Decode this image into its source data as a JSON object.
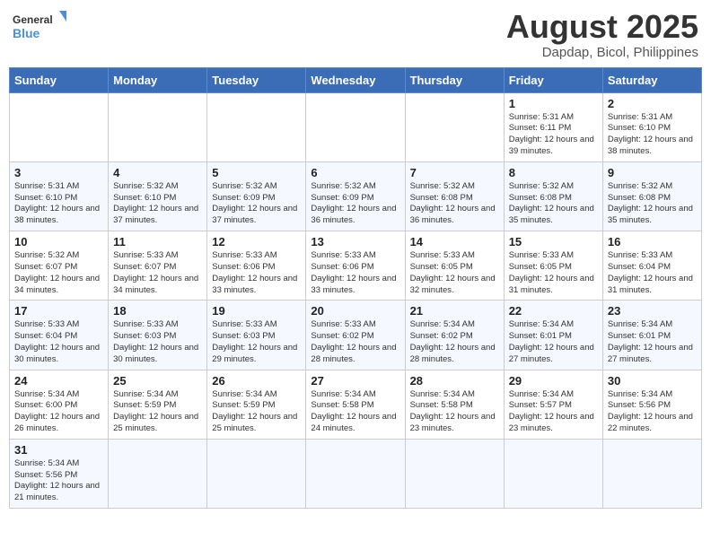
{
  "header": {
    "logo_general": "General",
    "logo_blue": "Blue",
    "title": "August 2025",
    "subtitle": "Dapdap, Bicol, Philippines"
  },
  "weekdays": [
    "Sunday",
    "Monday",
    "Tuesday",
    "Wednesday",
    "Thursday",
    "Friday",
    "Saturday"
  ],
  "weeks": [
    [
      {
        "day": "",
        "info": ""
      },
      {
        "day": "",
        "info": ""
      },
      {
        "day": "",
        "info": ""
      },
      {
        "day": "",
        "info": ""
      },
      {
        "day": "",
        "info": ""
      },
      {
        "day": "1",
        "info": "Sunrise: 5:31 AM\nSunset: 6:11 PM\nDaylight: 12 hours and 39 minutes."
      },
      {
        "day": "2",
        "info": "Sunrise: 5:31 AM\nSunset: 6:10 PM\nDaylight: 12 hours and 38 minutes."
      }
    ],
    [
      {
        "day": "3",
        "info": "Sunrise: 5:31 AM\nSunset: 6:10 PM\nDaylight: 12 hours and 38 minutes."
      },
      {
        "day": "4",
        "info": "Sunrise: 5:32 AM\nSunset: 6:10 PM\nDaylight: 12 hours and 37 minutes."
      },
      {
        "day": "5",
        "info": "Sunrise: 5:32 AM\nSunset: 6:09 PM\nDaylight: 12 hours and 37 minutes."
      },
      {
        "day": "6",
        "info": "Sunrise: 5:32 AM\nSunset: 6:09 PM\nDaylight: 12 hours and 36 minutes."
      },
      {
        "day": "7",
        "info": "Sunrise: 5:32 AM\nSunset: 6:08 PM\nDaylight: 12 hours and 36 minutes."
      },
      {
        "day": "8",
        "info": "Sunrise: 5:32 AM\nSunset: 6:08 PM\nDaylight: 12 hours and 35 minutes."
      },
      {
        "day": "9",
        "info": "Sunrise: 5:32 AM\nSunset: 6:08 PM\nDaylight: 12 hours and 35 minutes."
      }
    ],
    [
      {
        "day": "10",
        "info": "Sunrise: 5:32 AM\nSunset: 6:07 PM\nDaylight: 12 hours and 34 minutes."
      },
      {
        "day": "11",
        "info": "Sunrise: 5:33 AM\nSunset: 6:07 PM\nDaylight: 12 hours and 34 minutes."
      },
      {
        "day": "12",
        "info": "Sunrise: 5:33 AM\nSunset: 6:06 PM\nDaylight: 12 hours and 33 minutes."
      },
      {
        "day": "13",
        "info": "Sunrise: 5:33 AM\nSunset: 6:06 PM\nDaylight: 12 hours and 33 minutes."
      },
      {
        "day": "14",
        "info": "Sunrise: 5:33 AM\nSunset: 6:05 PM\nDaylight: 12 hours and 32 minutes."
      },
      {
        "day": "15",
        "info": "Sunrise: 5:33 AM\nSunset: 6:05 PM\nDaylight: 12 hours and 31 minutes."
      },
      {
        "day": "16",
        "info": "Sunrise: 5:33 AM\nSunset: 6:04 PM\nDaylight: 12 hours and 31 minutes."
      }
    ],
    [
      {
        "day": "17",
        "info": "Sunrise: 5:33 AM\nSunset: 6:04 PM\nDaylight: 12 hours and 30 minutes."
      },
      {
        "day": "18",
        "info": "Sunrise: 5:33 AM\nSunset: 6:03 PM\nDaylight: 12 hours and 30 minutes."
      },
      {
        "day": "19",
        "info": "Sunrise: 5:33 AM\nSunset: 6:03 PM\nDaylight: 12 hours and 29 minutes."
      },
      {
        "day": "20",
        "info": "Sunrise: 5:33 AM\nSunset: 6:02 PM\nDaylight: 12 hours and 28 minutes."
      },
      {
        "day": "21",
        "info": "Sunrise: 5:34 AM\nSunset: 6:02 PM\nDaylight: 12 hours and 28 minutes."
      },
      {
        "day": "22",
        "info": "Sunrise: 5:34 AM\nSunset: 6:01 PM\nDaylight: 12 hours and 27 minutes."
      },
      {
        "day": "23",
        "info": "Sunrise: 5:34 AM\nSunset: 6:01 PM\nDaylight: 12 hours and 27 minutes."
      }
    ],
    [
      {
        "day": "24",
        "info": "Sunrise: 5:34 AM\nSunset: 6:00 PM\nDaylight: 12 hours and 26 minutes."
      },
      {
        "day": "25",
        "info": "Sunrise: 5:34 AM\nSunset: 5:59 PM\nDaylight: 12 hours and 25 minutes."
      },
      {
        "day": "26",
        "info": "Sunrise: 5:34 AM\nSunset: 5:59 PM\nDaylight: 12 hours and 25 minutes."
      },
      {
        "day": "27",
        "info": "Sunrise: 5:34 AM\nSunset: 5:58 PM\nDaylight: 12 hours and 24 minutes."
      },
      {
        "day": "28",
        "info": "Sunrise: 5:34 AM\nSunset: 5:58 PM\nDaylight: 12 hours and 23 minutes."
      },
      {
        "day": "29",
        "info": "Sunrise: 5:34 AM\nSunset: 5:57 PM\nDaylight: 12 hours and 23 minutes."
      },
      {
        "day": "30",
        "info": "Sunrise: 5:34 AM\nSunset: 5:56 PM\nDaylight: 12 hours and 22 minutes."
      }
    ],
    [
      {
        "day": "31",
        "info": "Sunrise: 5:34 AM\nSunset: 5:56 PM\nDaylight: 12 hours and 21 minutes."
      },
      {
        "day": "",
        "info": ""
      },
      {
        "day": "",
        "info": ""
      },
      {
        "day": "",
        "info": ""
      },
      {
        "day": "",
        "info": ""
      },
      {
        "day": "",
        "info": ""
      },
      {
        "day": "",
        "info": ""
      }
    ]
  ]
}
